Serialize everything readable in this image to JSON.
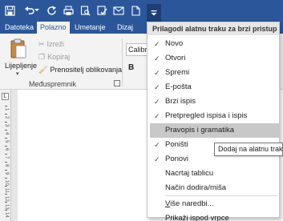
{
  "qat": {
    "icons": [
      "save-icon",
      "undo-icon",
      "redo-icon",
      "print-icon",
      "print-preview-icon",
      "spelling-icon",
      "email-icon",
      "new-document-icon",
      "customize-qat-icon"
    ]
  },
  "tabs": [
    {
      "label": "Datoteka"
    },
    {
      "label": "Polazno"
    },
    {
      "label": "Umetanje"
    },
    {
      "label": "Dizaj"
    }
  ],
  "clipboard": {
    "paste_label": "Lijepljenje",
    "cut_label": "Izreži",
    "copy_label": "Kopiraj",
    "format_painter_label": "Prenositelj oblikovanja",
    "group_label": "Međuspremnik"
  },
  "font": {
    "name_value": "Calibr",
    "bold_label": "B"
  },
  "menu": {
    "title": "Prilagodi alatnu traku za brzi pristup",
    "items": [
      {
        "label": "Novo",
        "checked": true
      },
      {
        "label": "Otvori",
        "checked": true
      },
      {
        "label": "Spremi",
        "checked": true
      },
      {
        "label": "E-pošta",
        "checked": true
      },
      {
        "label": "Brzi ispis",
        "checked": true
      },
      {
        "label": "Pretpregled ispisa i ispis",
        "checked": true
      },
      {
        "label": "Pravopis i gramatika",
        "checked": false
      },
      {
        "label": "Poništi",
        "checked": true
      },
      {
        "label": "Ponovi",
        "checked": true
      },
      {
        "label": "Nacrtaj tablicu",
        "checked": false
      },
      {
        "label": "Način dodira/miša",
        "checked": false
      },
      {
        "label": "Više naredbi...",
        "checked": false
      },
      {
        "label": "Prikaži ispod vrpce",
        "checked": false
      }
    ]
  },
  "tooltip": {
    "text": "Dodaj na alatnu traku"
  },
  "ruler": {
    "corner": "L",
    "numbers": [
      "1",
      "2",
      "3",
      "4",
      "5",
      "6",
      "7",
      "8",
      "9",
      "10",
      "11",
      "12",
      "13",
      "14"
    ]
  },
  "colors": {
    "accent": "#2b579a",
    "hover": "#c8c8c8"
  }
}
